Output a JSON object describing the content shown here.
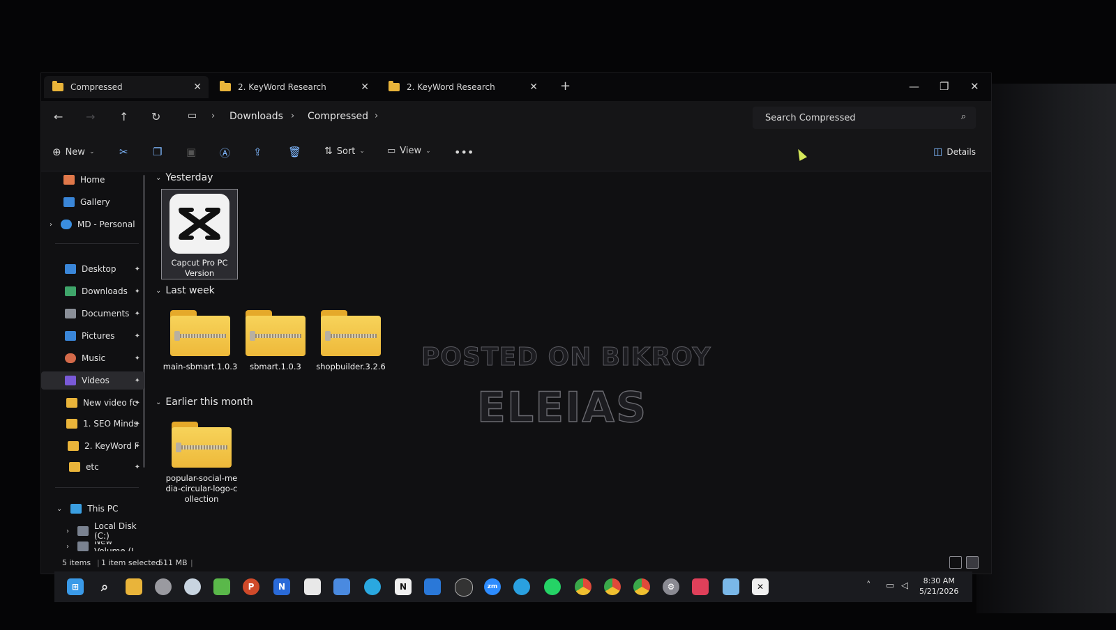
{
  "tabs": [
    {
      "label": "Compressed",
      "active": true
    },
    {
      "label": "2. KeyWord Research",
      "active": false
    },
    {
      "label": "2. KeyWord Research",
      "active": false
    }
  ],
  "breadcrumb": [
    "Downloads",
    "Compressed"
  ],
  "search": {
    "placeholder": "Search Compressed"
  },
  "toolbar": {
    "new_label": "New",
    "sort_label": "Sort",
    "view_label": "View",
    "details_label": "Details"
  },
  "sidebar": {
    "home": "Home",
    "gallery": "Gallery",
    "onedrive": "MD - Personal",
    "pinned": [
      {
        "label": "Desktop",
        "color": "#3a86d8"
      },
      {
        "label": "Downloads",
        "color": "#3fa56a"
      },
      {
        "label": "Documents",
        "color": "#8a8f98"
      },
      {
        "label": "Pictures",
        "color": "#3a86d8"
      },
      {
        "label": "Music",
        "color": "#d46a4a"
      },
      {
        "label": "Videos",
        "color": "#7a5ad8"
      },
      {
        "label": "New video fc",
        "color": "#e9b43a"
      },
      {
        "label": "1. SEO Minds",
        "color": "#e9b43a"
      },
      {
        "label": "2. KeyWord F",
        "color": "#e9b43a"
      },
      {
        "label": "etc",
        "color": "#e9b43a"
      }
    ],
    "this_pc": "This PC",
    "local_disk": "Local Disk (C:)",
    "new_volume": "New Volume (I"
  },
  "groups": {
    "yesterday": "Yesterday",
    "last_week": "Last week",
    "earlier": "Earlier this month"
  },
  "files": {
    "yesterday": [
      {
        "name": "Capcut Pro PC Version"
      }
    ],
    "last_week": [
      {
        "name": "main-sbmart.1.0.3"
      },
      {
        "name": "sbmart.1.0.3"
      },
      {
        "name": "shopbuilder.3.2.6"
      }
    ],
    "earlier": [
      {
        "name": "popular-social-media-circular-logo-collection"
      }
    ]
  },
  "status": {
    "count": "5 items",
    "selected": "1 item selected",
    "size": "511 MB"
  },
  "watermark": {
    "line1": "POSTED ON BIKROY",
    "line2": "ELEIAS"
  },
  "clock": {
    "time": "8:30 AM",
    "date": "5/21/2026"
  },
  "taskbar_icons": [
    "start-icon",
    "search-icon",
    "file-explorer-icon",
    "clock-app-icon",
    "browser-icon",
    "layers-icon",
    "powerpoint-icon",
    "word-icon",
    "notepad-icon",
    "notes-icon",
    "edge-icon",
    "notion-icon",
    "outlook-icon",
    "obs-icon",
    "zoom-icon",
    "telegram-icon",
    "whatsapp-icon",
    "chrome-icon",
    "chrome-icon",
    "chrome-icon",
    "settings-icon",
    "recorder-icon",
    "remote-desktop-icon",
    "capcut-icon"
  ]
}
